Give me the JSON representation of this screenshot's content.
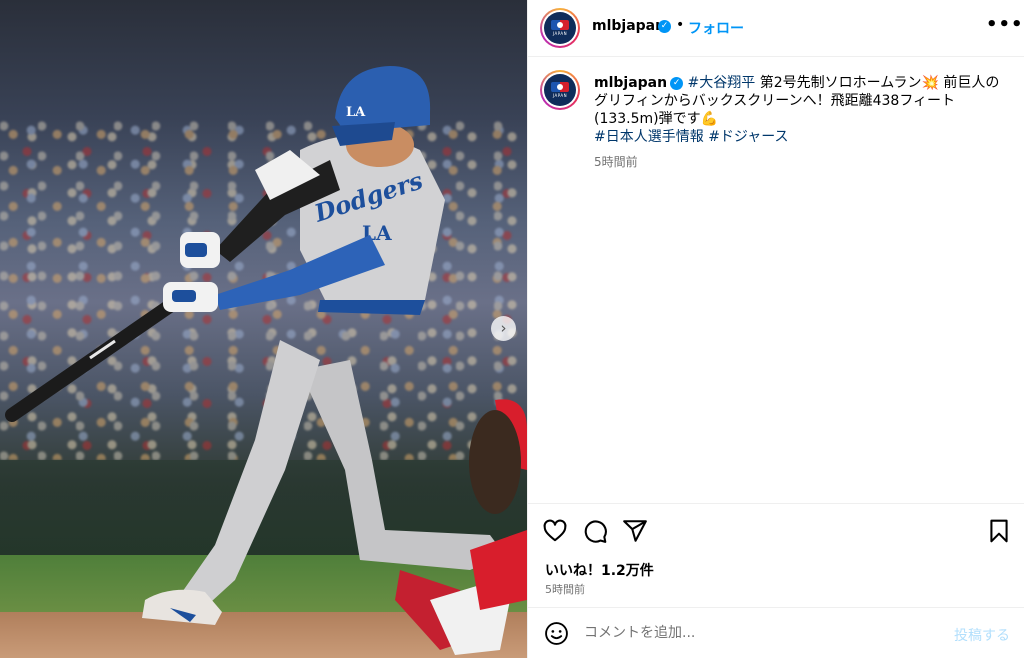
{
  "post": {
    "account": "mlbjapan",
    "verified": true,
    "follow_label": "フォロー",
    "more_label": "•••",
    "caption_parts": {
      "hashtag1": "#大谷翔平",
      "text": " 第2号先制ソロホームラン💥 前巨人のグリフィンからバックスクリーンへ！飛距離438フィート(133.5m)弾です💪",
      "hashtag2": "#日本人選手情報",
      "hashtag3": "#ドジャース"
    },
    "caption_time": "5時間前",
    "likes_text": "いいね！1.2万件",
    "post_time": "5時間前"
  },
  "comment": {
    "placeholder": "コメントを追加...",
    "post_label": "投稿する"
  },
  "photo": {
    "jersey_text": "Dodgers",
    "cap_logo": "LA",
    "sleeve_logo": "LA",
    "next_arrow": "›"
  },
  "colors": {
    "accent_blue": "#0095f6",
    "hashtag": "#00376b",
    "muted": "#737373",
    "dodger_blue": "#1d4f9c"
  },
  "icons": [
    "heart-icon",
    "comment-icon",
    "share-icon",
    "bookmark-icon",
    "emoji-icon",
    "verified-badge-icon",
    "next-arrow-icon"
  ]
}
